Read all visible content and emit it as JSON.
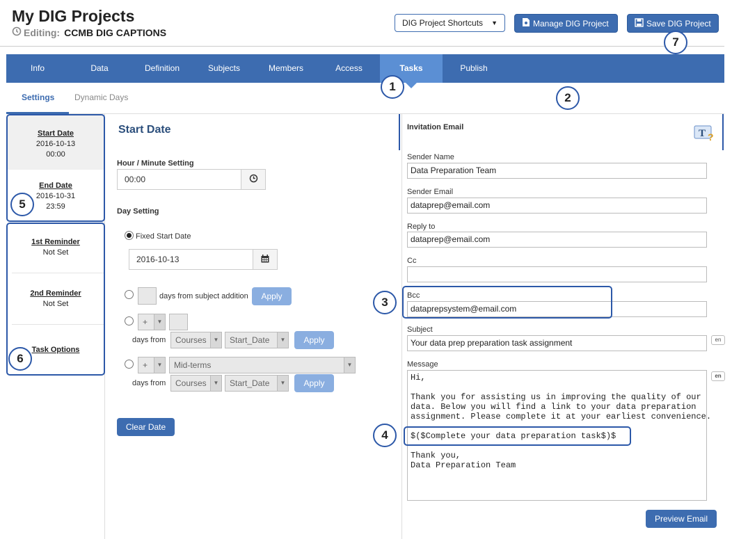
{
  "header": {
    "title": "My DIG Projects",
    "editing_label": "Editing:",
    "editing_value": "CCMB DIG CAPTIONS",
    "shortcuts_label": "DIG Project Shortcuts",
    "manage_label": "Manage DIG Project",
    "save_label": "Save DIG Project"
  },
  "nav": {
    "items": [
      "Info",
      "Data",
      "Definition",
      "Subjects",
      "Members",
      "Access",
      "Tasks",
      "Publish"
    ],
    "active": "Tasks"
  },
  "subtabs": {
    "settings": "Settings",
    "dynamic": "Dynamic Days"
  },
  "sidebar": {
    "start": {
      "title": "Start Date",
      "date": "2016-10-13",
      "time": "00:00"
    },
    "end": {
      "title": "End Date",
      "date": "2016-10-31",
      "time": "23:59"
    },
    "rem1": {
      "title": "1st Reminder",
      "value": "Not Set"
    },
    "rem2": {
      "title": "2nd Reminder",
      "value": "Not Set"
    },
    "options": {
      "title": "Task Options"
    }
  },
  "middle": {
    "title": "Start Date",
    "hour_label": "Hour / Minute Setting",
    "hour_value": "00:00",
    "day_label": "Day Setting",
    "fixed_label": "Fixed Start Date",
    "fixed_value": "2016-10-13",
    "days_from_addition": "days from subject addition",
    "apply": "Apply",
    "plus": "+",
    "days_from": "days from",
    "courses": "Courses",
    "start_date_opt": "Start_Date",
    "midterms": "Mid-terms",
    "clear": "Clear Date"
  },
  "right": {
    "title": "Invitation Email",
    "sender_name_label": "Sender Name",
    "sender_name": "Data Preparation Team",
    "sender_email_label": "Sender Email",
    "sender_email": "dataprep@email.com",
    "reply_label": "Reply to",
    "reply": "dataprep@email.com",
    "cc_label": "Cc",
    "cc": "",
    "bcc_label": "Bcc",
    "bcc": "dataprepsystem@email.com",
    "subject_label": "Subject",
    "subject": "Your data prep preparation task assignment",
    "message_label": "Message",
    "message": "Hi,\n\nThank you for assisting us in improving the quality of our\ndata. Below you will find a link to your data preparation\nassignment. Please complete it at your earliest convenience.\n\n$($Complete your data preparation task$)$\n\nThank you,\nData Preparation Team",
    "lang": "en",
    "preview": "Preview Email"
  },
  "callouts": [
    "1",
    "2",
    "3",
    "4",
    "5",
    "6",
    "7"
  ],
  "colors": {
    "primary": "#3d6cb0",
    "nav_active": "#5b8fd4",
    "callout": "#2c58a8"
  }
}
